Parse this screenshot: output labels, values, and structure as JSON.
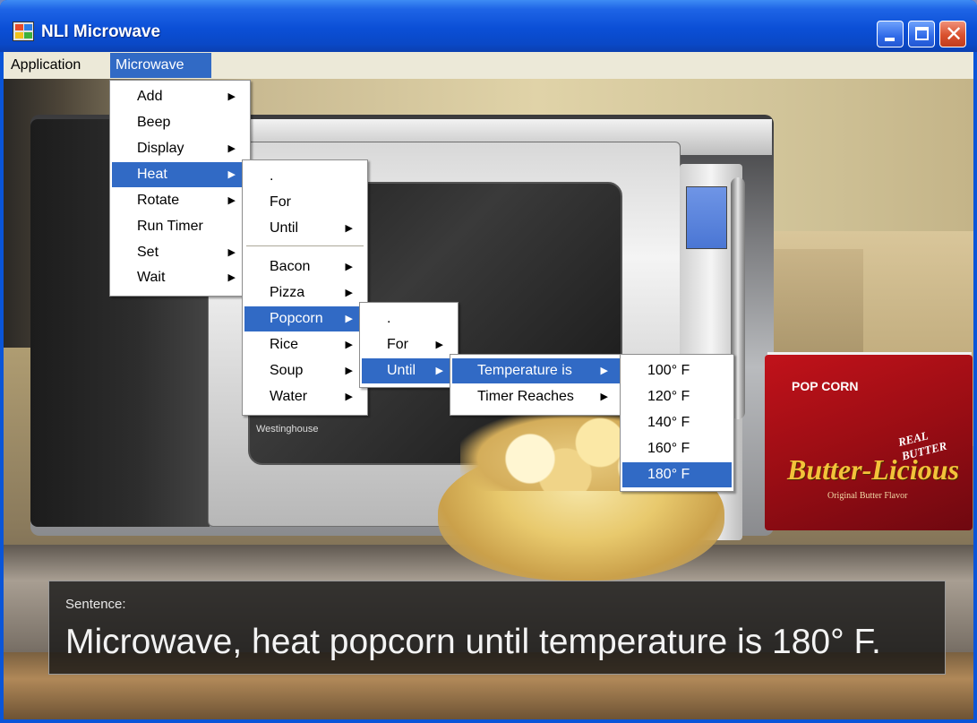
{
  "window": {
    "title": "NLI Microwave",
    "close_glyph": "✕"
  },
  "menubar": {
    "items": [
      "Application",
      "Microwave"
    ],
    "active": "Microwave"
  },
  "menus": {
    "microwave": {
      "items": [
        {
          "label": "Add",
          "submenu": true
        },
        {
          "label": "Beep",
          "submenu": false
        },
        {
          "label": "Display",
          "submenu": true
        },
        {
          "label": "Heat",
          "submenu": true,
          "selected": true
        },
        {
          "label": "Rotate",
          "submenu": true
        },
        {
          "label": "Run Timer",
          "submenu": false
        },
        {
          "label": "Set",
          "submenu": true
        },
        {
          "label": "Wait",
          "submenu": true
        }
      ]
    },
    "heat": {
      "items": [
        {
          "label": ".",
          "submenu": false
        },
        {
          "label": "For",
          "submenu": false
        },
        {
          "label": "Until",
          "submenu": true
        },
        {
          "label": "Bacon",
          "submenu": true
        },
        {
          "label": "Pizza",
          "submenu": true
        },
        {
          "label": "Popcorn",
          "submenu": true,
          "selected": true
        },
        {
          "label": "Rice",
          "submenu": true
        },
        {
          "label": "Soup",
          "submenu": true
        },
        {
          "label": "Water",
          "submenu": true
        }
      ]
    },
    "popcorn": {
      "items": [
        {
          "label": ".",
          "submenu": false
        },
        {
          "label": "For",
          "submenu": true
        },
        {
          "label": "Until",
          "submenu": true,
          "selected": true
        }
      ]
    },
    "until": {
      "items": [
        {
          "label": "Temperature is",
          "submenu": true,
          "selected": true
        },
        {
          "label": "Timer Reaches",
          "submenu": true
        }
      ]
    },
    "temperature": {
      "items": [
        {
          "label": "100° F"
        },
        {
          "label": "120° F"
        },
        {
          "label": "140° F"
        },
        {
          "label": "160° F"
        },
        {
          "label": "180° F",
          "selected": true
        }
      ]
    },
    "arrow_glyph": "▶"
  },
  "scene": {
    "microwave_brand": "Westinghouse",
    "popcorn_box": {
      "label": "POP CORN",
      "brand": "Butter-Licious",
      "tagline": "REAL BUTTER",
      "sub": "Original Butter Flavor"
    }
  },
  "sentence": {
    "label": "Sentence:",
    "text": "Microwave, heat popcorn until temperature is 180° F."
  },
  "colors": {
    "titlebar": "#0a48c6",
    "menu_highlight": "#316ac5",
    "menubar": "#ece9d8",
    "close_button": "#d9512e"
  }
}
